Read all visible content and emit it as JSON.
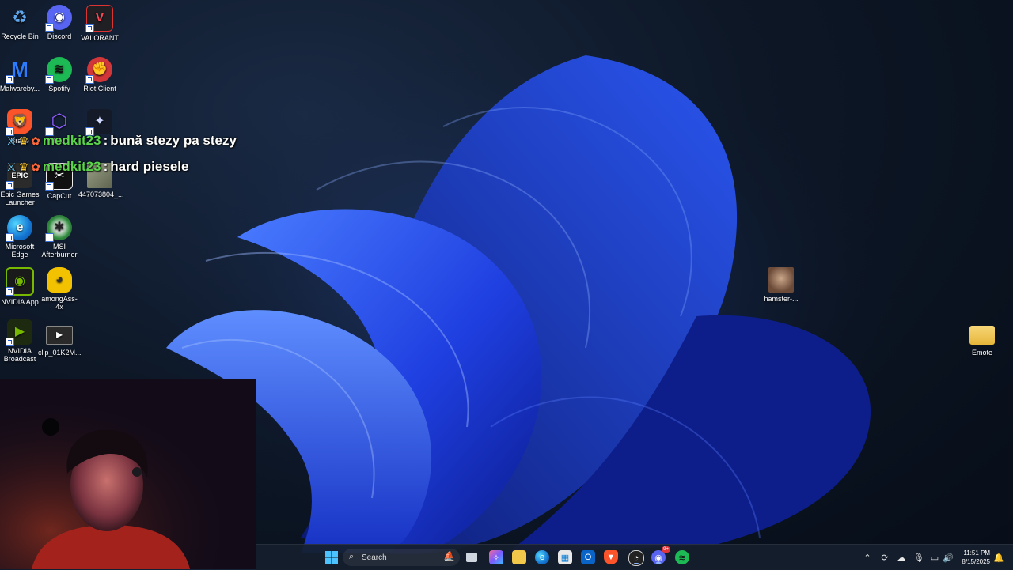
{
  "desktop": {
    "icons": [
      {
        "label": "Recycle Bin",
        "icon": "recycle-bin-icon",
        "color": "#3d8be0"
      },
      {
        "label": "Discord",
        "icon": "discord-icon",
        "color": "#5865f2"
      },
      {
        "label": "VALORANT",
        "icon": "valorant-icon",
        "color": "#1f1f24"
      },
      {
        "label": "Malwareby...",
        "icon": "malwarebytes-icon",
        "color": "#1c5fd9"
      },
      {
        "label": "Spotify",
        "icon": "spotify-icon",
        "color": "#1db954"
      },
      {
        "label": "Riot Client",
        "icon": "riot-client-icon",
        "color": "#d13639"
      },
      {
        "label": "Brave",
        "icon": "brave-icon",
        "color": "#fb542b"
      },
      {
        "label": "Kl...",
        "icon": "cube-app-icon",
        "color": "#4a2c88"
      },
      {
        "label": "",
        "icon": "game-app-icon",
        "color": "#151a28"
      },
      {
        "label": "Epic Games Launcher",
        "icon": "epic-games-icon",
        "color": "#2b2b2b"
      },
      {
        "label": "CapCut",
        "icon": "capcut-icon",
        "color": "#111111"
      },
      {
        "label": "447073804_...",
        "icon": "image-file-icon",
        "color": "#8a8f7a"
      },
      {
        "label": "Microsoft Edge",
        "icon": "edge-icon",
        "color": "#1476d2"
      },
      {
        "label": "MSI Afterburner",
        "icon": "msi-afterburner-icon",
        "color": "#2c8a3a"
      },
      {
        "label": "NVIDIA App",
        "icon": "nvidia-app-icon",
        "color": "#76b900"
      },
      {
        "label": "amongAss-4x",
        "icon": "emote-file-icon",
        "color": "#f2c200"
      },
      {
        "label": "NVIDIA Broadcast",
        "icon": "nvidia-broadcast-icon",
        "color": "#3e6b15"
      },
      {
        "label": "clip_01K2M...",
        "icon": "video-file-icon",
        "color": "#333333"
      },
      {
        "label": "hamster-...",
        "icon": "image-file-icon",
        "color": "#8a6a55"
      },
      {
        "label": "Emote",
        "icon": "folder-icon",
        "color": "#f2c84b"
      }
    ]
  },
  "chat": [
    {
      "user": "medkit23",
      "message": "bună stezy pa stezy"
    },
    {
      "user": "medkit23",
      "message": "hard piesele"
    }
  ],
  "taskbar": {
    "search_placeholder": "Search",
    "badge_count": "9+",
    "time": "11:51 PM",
    "date": "8/15/2025"
  }
}
